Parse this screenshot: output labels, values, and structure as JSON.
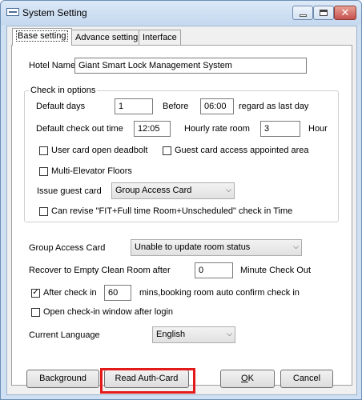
{
  "window": {
    "title": "System Setting",
    "minimize_label": "",
    "maximize_label": "",
    "close_glyph": "✕"
  },
  "tabs": [
    {
      "label": "Base setting",
      "active": true
    },
    {
      "label": "Advance setting",
      "active": false
    },
    {
      "label": "Interface",
      "active": false
    }
  ],
  "hotel": {
    "label": "Hotel Name",
    "value": "Giant Smart Lock Management System"
  },
  "checkin_options": {
    "title": "Check in options",
    "default_days_label": "Default days",
    "default_days_value": "1",
    "before_label": "Before",
    "before_value": "06:00",
    "regard_label": "regard as last day",
    "checkout_time_label": "Default check out time",
    "checkout_time_value": "12:05",
    "hourly_label": "Hourly rate room",
    "hourly_value": "3",
    "hour_unit": "Hour",
    "user_card_deadbolt": {
      "label": "User card open deadbolt",
      "checked": false
    },
    "guest_card_appointed": {
      "label": "Guest card access appointed area",
      "checked": false
    },
    "multi_elevator": {
      "label": "Multi-Elevator Floors",
      "checked": false
    },
    "issue_guest_card_label": "Issue guest card",
    "issue_guest_card_value": "Group Access Card",
    "can_revise": {
      "label": "Can revise \"FIT+Full time Room+Unscheduled\" check in Time",
      "checked": false
    }
  },
  "group_access": {
    "label": "Group Access Card",
    "value": "Unable to update room status"
  },
  "recover": {
    "label": "Recover to Empty Clean Room after",
    "value": "0",
    "suffix": "Minute Check Out"
  },
  "after_checkin": {
    "label": "After check in",
    "checked": true,
    "check_glyph": "✓",
    "value": "60",
    "suffix": "mins,booking room auto confirm check in"
  },
  "open_checkin_window": {
    "label": "Open check-in window after login",
    "checked": false
  },
  "language": {
    "label": "Current Language",
    "value": "English"
  },
  "combo_arrow": "⌵",
  "buttons": {
    "background": "Background",
    "read_auth_card": "Read Auth-Card",
    "ok_mnemonic": "O",
    "ok_rest": "K",
    "cancel": "Cancel"
  },
  "colors": {
    "highlight": "#e3191a",
    "title_bar": "#c4d8ef",
    "close_button": "#c75050"
  }
}
